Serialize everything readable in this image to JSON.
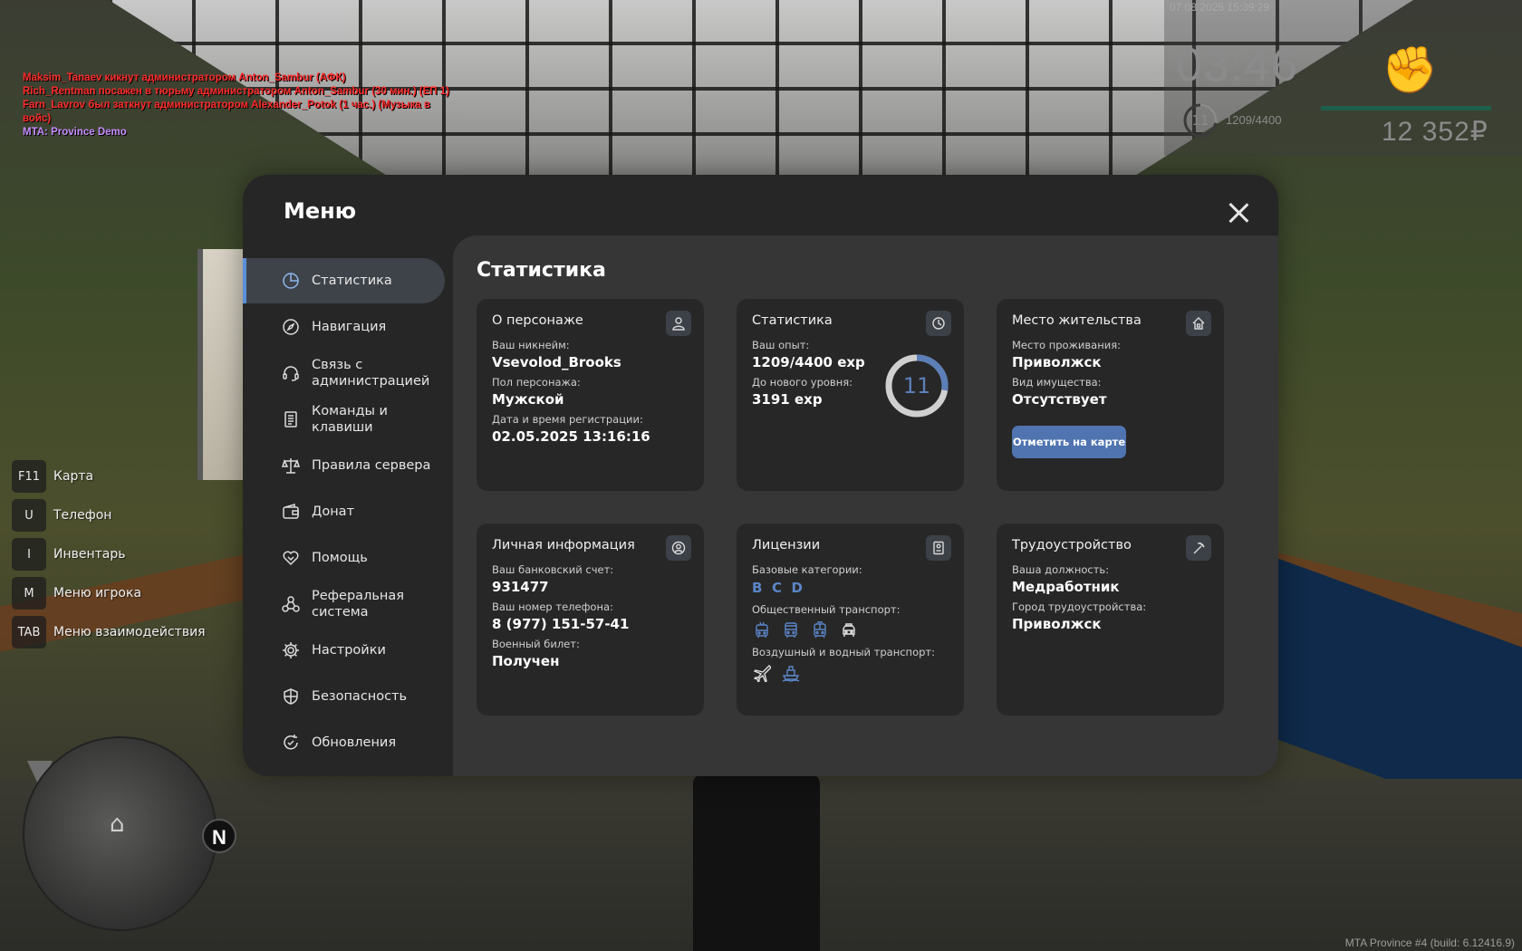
{
  "chat": [
    {
      "text": "Maksim_Tanaev кикнут администратором Anton_Sambur (АФК)",
      "kind": "admin"
    },
    {
      "text": "Rich_Rentman посажен в тюрьму администратором Anton_Sambur (30 мин.) (ЕП 1)",
      "kind": "admin"
    },
    {
      "text": "Farn_Lavrov был заткнут администратором Alexander_Potok (1 час.) (Музыка в войс)",
      "kind": "admin"
    },
    {
      "text": "MTA: Province Demo",
      "kind": "sys"
    }
  ],
  "hud": {
    "date": "07.08.2025 15:39:29",
    "time": "03:46",
    "level": "11",
    "exp": "1209/4400",
    "money": "12 352₽",
    "icon": "fist-icon"
  },
  "hotkeys": [
    {
      "key": "F11",
      "label": "Карта"
    },
    {
      "key": "U",
      "label": "Телефон"
    },
    {
      "key": "I",
      "label": "Инвентарь"
    },
    {
      "key": "M",
      "label": "Меню игрока"
    },
    {
      "key": "TAB",
      "label": "Меню взаимодействия"
    }
  ],
  "minimap": {
    "north": "N"
  },
  "build": "MTA Province #4 (build: 6.12416.9)",
  "menu": {
    "title": "Меню",
    "nav": [
      {
        "label": "Статистика",
        "icon": "pie-chart-icon",
        "active": true
      },
      {
        "label": "Навигация",
        "icon": "compass-icon"
      },
      {
        "label": "Связь с администрацией",
        "icon": "headset-icon"
      },
      {
        "label": "Команды и клавиши",
        "icon": "document-icon"
      },
      {
        "label": "Правила сервера",
        "icon": "scales-icon"
      },
      {
        "label": "Донат",
        "icon": "wallet-icon"
      },
      {
        "label": "Помощь",
        "icon": "handshake-icon"
      },
      {
        "label": "Реферальная система",
        "icon": "network-icon"
      },
      {
        "label": "Настройки",
        "icon": "gear-icon"
      },
      {
        "label": "Безопасность",
        "icon": "shield-icon"
      },
      {
        "label": "Обновления",
        "icon": "refresh-icon"
      }
    ]
  },
  "stats": {
    "title": "Статистика",
    "character": {
      "title": "О персонаже",
      "nick_label": "Ваш никнейм:",
      "nick": "Vsevolod_Brooks",
      "gender_label": "Пол персонажа:",
      "gender": "Мужской",
      "reg_label": "Дата и время регистрации:",
      "reg": "02.05.2025 13:16:16"
    },
    "statistics": {
      "title": "Статистика",
      "exp_label": "Ваш опыт:",
      "exp": "1209/4400 exp",
      "next_label": "До нового уровня:",
      "next": "3191 exp",
      "level": "11",
      "progress": 0.275
    },
    "residence": {
      "title": "Место жительства",
      "place_label": "Место проживания:",
      "place": "Приволжск",
      "property_label": "Вид имущества:",
      "property": "Отсутствует",
      "button": "Отметить на карте"
    },
    "personal": {
      "title": "Личная информация",
      "bank_label": "Ваш банковский счет:",
      "bank": "931477",
      "phone_label": "Ваш номер телефона:",
      "phone": "8 (977) 151-57-41",
      "military_label": "Военный билет:",
      "military": "Получен"
    },
    "licenses": {
      "title": "Лицензии",
      "base_label": "Базовые категории:",
      "base": [
        "B",
        "C",
        "D"
      ],
      "public_label": "Общественный транспорт:",
      "public": [
        {
          "icon": "trolleybus-icon",
          "owned": false
        },
        {
          "icon": "bus-icon",
          "owned": false
        },
        {
          "icon": "tram-icon",
          "owned": false
        },
        {
          "icon": "taxi-icon",
          "owned": true
        }
      ],
      "air_label": "Воздушный и водный транспорт:",
      "air": [
        {
          "icon": "plane-icon",
          "owned": true
        },
        {
          "icon": "ship-icon",
          "owned": false
        }
      ]
    },
    "employment": {
      "title": "Трудоустройство",
      "position_label": "Ваша должность:",
      "position": "Медработник",
      "city_label": "Город трудоустройства:",
      "city": "Приволжск"
    }
  }
}
